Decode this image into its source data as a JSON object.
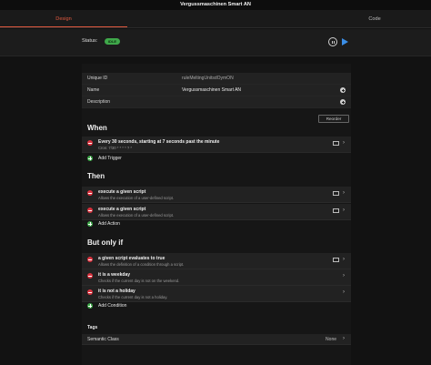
{
  "window": {
    "title": "Vergussmaschinen Smart AN"
  },
  "tabs": [
    {
      "label": "Design"
    },
    {
      "label": "Code"
    }
  ],
  "status": {
    "label": "Status:",
    "badge": "IDLE"
  },
  "info": {
    "uid_label": "Unique ID",
    "uid_value": "ruleMeltingUnitsdOymON",
    "name_label": "Name",
    "name_value": "Vergussmaschinen Smart AN",
    "desc_label": "Description"
  },
  "reorder_label": "Reorder",
  "when": {
    "title": "When",
    "items": [
      {
        "title": "Every 30 seconds, starting at 7 seconds past the minute",
        "sub": "Cron: 7/30 * * * * ? *"
      }
    ],
    "add_label": "Add Trigger"
  },
  "then": {
    "title": "Then",
    "items": [
      {
        "title": "execute a given script",
        "sub": "Allows the execution of a user-defined script."
      },
      {
        "title": "execute a given script",
        "sub": "Allows the execution of a user-defined script."
      }
    ],
    "add_label": "Add Action"
  },
  "but_only_if": {
    "title": "But only if",
    "items": [
      {
        "title": "a given script evaluates to true",
        "sub": "Allows the definition of a condition through a script."
      },
      {
        "title": "it is a weekday",
        "sub": "Checks if the current day is not on the weekend."
      },
      {
        "title": "it is not a holiday",
        "sub": "Checks if the current day is not a holiday."
      }
    ],
    "add_label": "Add Condition"
  },
  "tags": {
    "label": "Tags"
  },
  "semantic": {
    "label": "Semantic Class",
    "value": "None"
  },
  "colors": {
    "accent": "#e0593f",
    "status_green": "#3fa84a",
    "remove_red": "#d9333f",
    "play_blue": "#3b8ee6"
  },
  "icons": {
    "remove": "minus-circle-icon",
    "add": "plus-circle-icon",
    "edit": "code-edit-icon",
    "chevron": "chevron-right-icon",
    "pause": "pause-icon",
    "play": "play-icon"
  }
}
